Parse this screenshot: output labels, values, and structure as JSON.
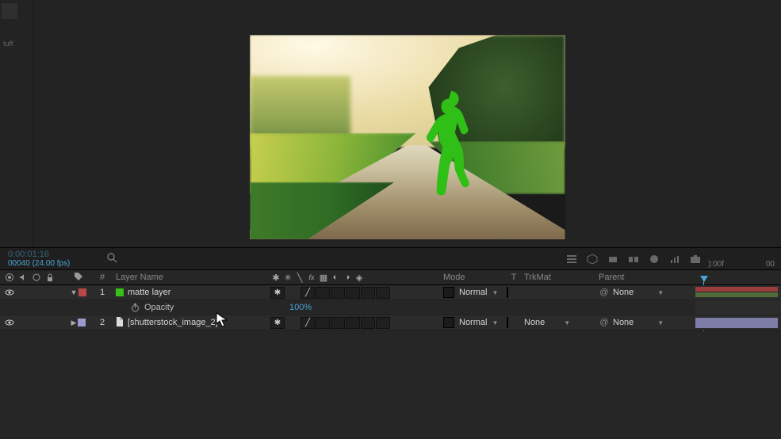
{
  "timecode": {
    "main": "0:00:01:16",
    "sub": "00040 (24.00 fps)"
  },
  "timeRuler": {
    "start": "):00f",
    "end": "00"
  },
  "columns": {
    "layerName": "Layer Name",
    "mode": "Mode",
    "t": "T",
    "trkMat": "TrkMat",
    "parent": "Parent"
  },
  "layers": [
    {
      "index": "1",
      "name": "matte layer",
      "swatch": "green",
      "tagColor": "red",
      "mode": "Normal",
      "trkMat": "",
      "parent": "None",
      "expanded": true,
      "visible": true
    },
    {
      "index": "2",
      "name": "[shutterstock_image_2]",
      "swatch": "file",
      "tagColor": "purple",
      "mode": "Normal",
      "trkMat": "None",
      "parent": "None",
      "expanded": false,
      "visible": true
    }
  ],
  "property": {
    "name": "Opacity",
    "value": "100%"
  },
  "leftPanelLabel": "tuff"
}
